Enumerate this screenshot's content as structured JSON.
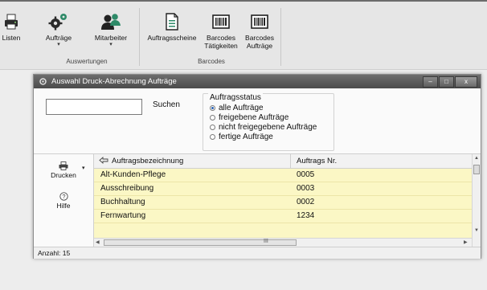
{
  "ribbon": {
    "buttons": [
      {
        "label": "Listen",
        "icon": "print-icon"
      },
      {
        "label": "Aufträge",
        "icon": "gears-icon",
        "arrow": "▾"
      },
      {
        "label": "Mitarbeiter",
        "icon": "people-icon",
        "arrow": "▾"
      },
      {
        "label": "Auftragsscheine",
        "icon": "document-icon"
      },
      {
        "label": "Barcodes Tätigkeiten",
        "line1": "Barcodes",
        "line2": "Tätigkeiten",
        "icon": "barcode-icon"
      },
      {
        "label": "Barcodes Aufträge",
        "line1": "Barcodes",
        "line2": "Aufträge",
        "icon": "barcode-icon"
      }
    ],
    "groups": {
      "auswertungen": "Auswertungen",
      "barcodes": "Barcodes"
    }
  },
  "window": {
    "title": "Auswahl Druck-Abrechnung Aufträge",
    "controls": {
      "minimize": "–",
      "maximize": "□",
      "close": "x"
    }
  },
  "filter": {
    "search_value": "",
    "search_label": "Suchen",
    "status_title": "Auftragsstatus",
    "options": [
      {
        "label": "alle Aufträge",
        "selected": true
      },
      {
        "label": "freigebene Aufträge",
        "selected": false
      },
      {
        "label": "nicht freigegebene Aufträge",
        "selected": false
      },
      {
        "label": "fertige Aufträge",
        "selected": false
      }
    ]
  },
  "side": {
    "print_label": "Drucken",
    "help_label": "Hilfe"
  },
  "grid": {
    "columns": [
      "Auftragsbezeichnung",
      "Auftrags Nr."
    ],
    "rows": [
      {
        "name": "Alt-Kunden-Pflege",
        "nr": "0005"
      },
      {
        "name": "Ausschreibung",
        "nr": "0003"
      },
      {
        "name": "Buchhaltung",
        "nr": "0002"
      },
      {
        "name": "Fernwartung",
        "nr": "1234"
      }
    ],
    "scroll_grip": "III"
  },
  "status": {
    "count_label": "Anzahl: 15"
  },
  "colors": {
    "row_highlight": "#fbf7c5",
    "titlebar": "#5a5a5a",
    "icon_green": "#2e7d6b"
  }
}
